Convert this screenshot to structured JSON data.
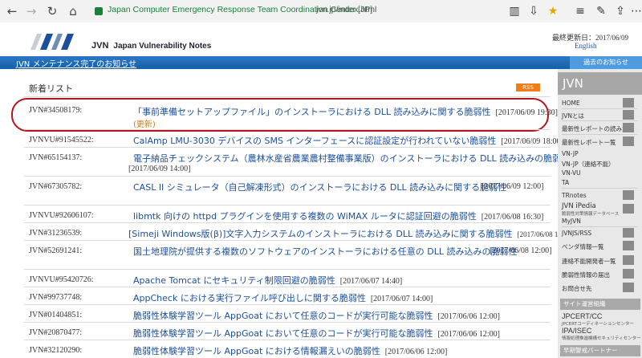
{
  "browser": {
    "site_identity": "Japan Computer Emergency Response Team Coordination Center [JP]",
    "url": "jvn.jp/index.html"
  },
  "header": {
    "logo_text_big": "JVN",
    "logo_text": "Japan Vulnerability Notes",
    "last_updated": "最終更新日：2017/06/09",
    "english_link": "English",
    "notice": "JVN メンテナンス完了のお知らせ",
    "past_notices": "過去のお知らせ"
  },
  "main": {
    "section_title": "新着リスト",
    "rss_label": "RSS",
    "updated_label": "(更新)",
    "entries": [
      {
        "id": "JVN#34508179:",
        "title": "「事前準備セットアップファイル」のインストーラにおける DLL 読み込みに関する脆弱性",
        "date": "[2017/06/09 19:30]"
      },
      {
        "id": "JVNVU#91545522:",
        "title": "CalAmp LMU-3030 デバイスの SMS インターフェースに認証設定が行われていない脆弱性",
        "date": "[2017/06/09 18:00]"
      },
      {
        "id": "JVN#65154137:",
        "title": "電子納品チェックシステム（農林水産省農業農村整備事業版）のインストーラにおける DLL 読み込みの脆弱性",
        "date": "[2017/06/09 14:00]"
      },
      {
        "id": "JVN#67305782:",
        "title": "CASL II シミュレータ（自己解凍形式）のインストーラにおける DLL 読み込みに関する脆弱性",
        "date": "[2017/06/09 12:00]"
      },
      {
        "id": "JVNVU#92606107:",
        "title": "libmtk 向けの httpd プラグインを使用する複数の WiMAX ルータに認証回避の脆弱性",
        "date": "[2017/06/08 16:30]"
      },
      {
        "id": "JVN#31236539:",
        "title": "[Simeji Windows版(β)]文字入力システムのインストーラにおける DLL 読み込みに関する脆弱性",
        "date": "[2017/06/08 12:00]"
      },
      {
        "id": "JVN#52691241:",
        "title": "国土地理院が提供する複数のソフトウェアのインストーラにおける任意の DLL 読み込みの脆弱性",
        "date": "[2017/06/08 12:00]"
      },
      {
        "id": "JVNVU#95420726:",
        "title": "Apache Tomcat にセキュリティ制限回避の脆弱性",
        "date": "[2017/06/07 14:40]"
      },
      {
        "id": "JVN#99737748:",
        "title": "AppCheck における実行ファイル呼び出しに関する脆弱性",
        "date": "[2017/06/07 14:00]"
      },
      {
        "id": "JVN#01404851:",
        "title": "脆弱性体験学習ツール AppGoat において任意のコードが実行可能な脆弱性",
        "date": "[2017/06/06 12:00]"
      },
      {
        "id": "JVN#20870477:",
        "title": "脆弱性体験学習ツール AppGoat において任意のコードが実行可能な脆弱性",
        "date": "[2017/06/06 12:00]"
      },
      {
        "id": "JVN#32120290:",
        "title": "脆弱性体験学習ツール AppGoat における情報漏えいの脆弱性",
        "date": "[2017/06/06 12:00]"
      }
    ]
  },
  "sidebar": {
    "title": "JVN",
    "items": [
      "HOME",
      "JVNとは",
      "最新性レポートの読み方",
      "最新性レポート一覧",
      "VN-JP",
      "VN-JP（連絡不能）",
      "VN-VU",
      "TA",
      "TRnotes",
      "JVN iPedia",
      "脆弱性対策情報データベース",
      "MyJVN",
      "JVNJS/RSS",
      "ベンダ情報一覧",
      "連絡不能開発者一覧",
      "脆弱性情報の届出",
      "お問合せ先"
    ],
    "ops_header": "サイト運営組織",
    "org1": "JPCERT/CC",
    "org1_sub": "JPCERTコーディネーションセンター",
    "org2": "IPA/ISEC",
    "org2_sub": "情報処理推進機構セキュリティセンター",
    "partner_header": "早期警戒パートナー"
  }
}
